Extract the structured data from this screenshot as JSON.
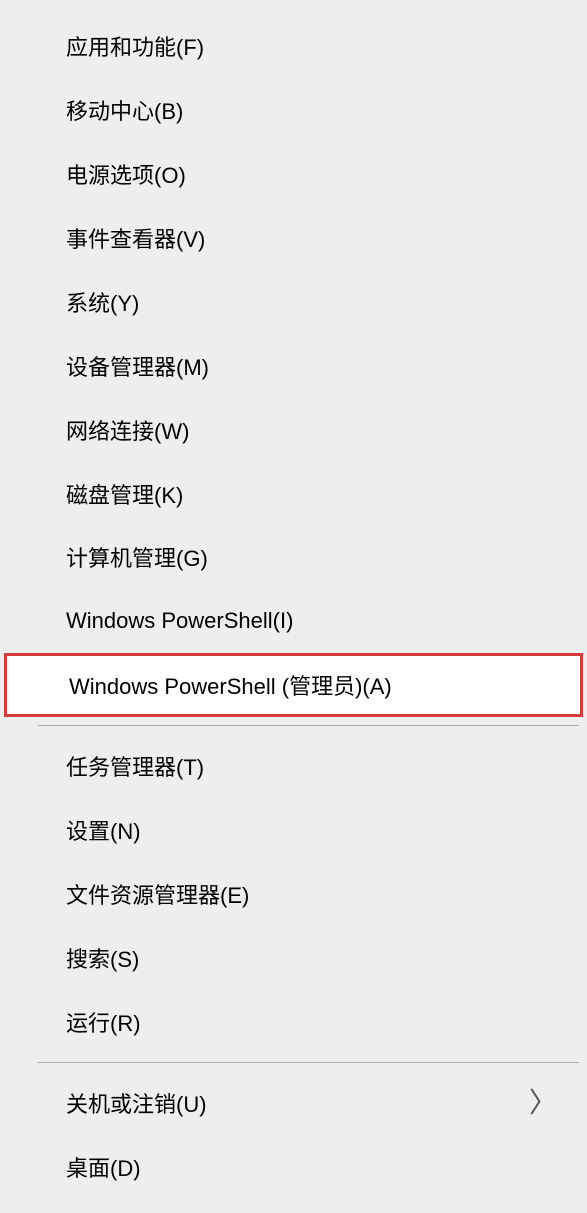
{
  "menu": {
    "groups": [
      {
        "items": [
          {
            "id": "apps-features",
            "label": "应用和功能(F)",
            "highlighted": false,
            "submenu": false
          },
          {
            "id": "mobility-center",
            "label": "移动中心(B)",
            "highlighted": false,
            "submenu": false
          },
          {
            "id": "power-options",
            "label": "电源选项(O)",
            "highlighted": false,
            "submenu": false
          },
          {
            "id": "event-viewer",
            "label": "事件查看器(V)",
            "highlighted": false,
            "submenu": false
          },
          {
            "id": "system",
            "label": "系统(Y)",
            "highlighted": false,
            "submenu": false
          },
          {
            "id": "device-manager",
            "label": "设备管理器(M)",
            "highlighted": false,
            "submenu": false
          },
          {
            "id": "network-connections",
            "label": "网络连接(W)",
            "highlighted": false,
            "submenu": false
          },
          {
            "id": "disk-management",
            "label": "磁盘管理(K)",
            "highlighted": false,
            "submenu": false
          },
          {
            "id": "computer-management",
            "label": "计算机管理(G)",
            "highlighted": false,
            "submenu": false
          },
          {
            "id": "powershell",
            "label": "Windows PowerShell(I)",
            "highlighted": false,
            "submenu": false
          },
          {
            "id": "powershell-admin",
            "label": "Windows PowerShell (管理员)(A)",
            "highlighted": true,
            "submenu": false
          }
        ]
      },
      {
        "items": [
          {
            "id": "task-manager",
            "label": "任务管理器(T)",
            "highlighted": false,
            "submenu": false
          },
          {
            "id": "settings",
            "label": "设置(N)",
            "highlighted": false,
            "submenu": false
          },
          {
            "id": "file-explorer",
            "label": "文件资源管理器(E)",
            "highlighted": false,
            "submenu": false
          },
          {
            "id": "search",
            "label": "搜索(S)",
            "highlighted": false,
            "submenu": false
          },
          {
            "id": "run",
            "label": "运行(R)",
            "highlighted": false,
            "submenu": false
          }
        ]
      },
      {
        "items": [
          {
            "id": "shutdown-signout",
            "label": "关机或注销(U)",
            "highlighted": false,
            "submenu": true
          },
          {
            "id": "desktop",
            "label": "桌面(D)",
            "highlighted": false,
            "submenu": false
          }
        ]
      }
    ],
    "chevron_glyph": "〉"
  }
}
